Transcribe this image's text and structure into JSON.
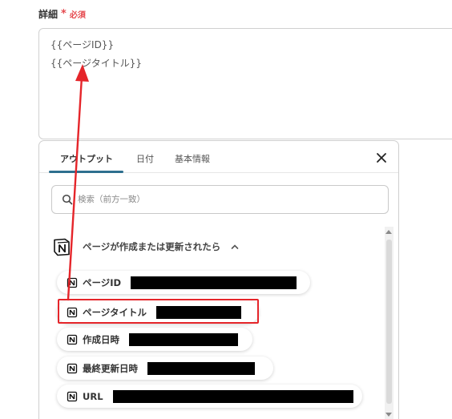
{
  "field": {
    "label": "詳細",
    "required_star": "*",
    "required_text": "必須",
    "lines": [
      "{{ページID}}",
      "{{ページタイトル}}"
    ]
  },
  "panel": {
    "tabs": [
      {
        "label": "アウトプット",
        "active": true
      },
      {
        "label": "日付",
        "active": false
      },
      {
        "label": "基本情報",
        "active": false
      }
    ],
    "search": {
      "placeholder": "検索（前方一致）",
      "value": ""
    },
    "section": {
      "title": "ページが作成または更新されたら",
      "icon": "notion-icon",
      "expanded": true
    },
    "items": [
      {
        "label": "ページID",
        "icon": "notion-icon",
        "redacted": true
      },
      {
        "label": "ページタイトル",
        "icon": "notion-icon",
        "redacted": true,
        "highlighted": true
      },
      {
        "label": "作成日時",
        "icon": "notion-icon",
        "redacted": true
      },
      {
        "label": "最終更新日時",
        "icon": "notion-icon",
        "redacted": true
      },
      {
        "label": "URL",
        "icon": "notion-icon",
        "redacted": true
      }
    ]
  },
  "colors": {
    "accent": "#2e6f8e",
    "required": "#e5484d",
    "annotation": "#e5252a"
  }
}
